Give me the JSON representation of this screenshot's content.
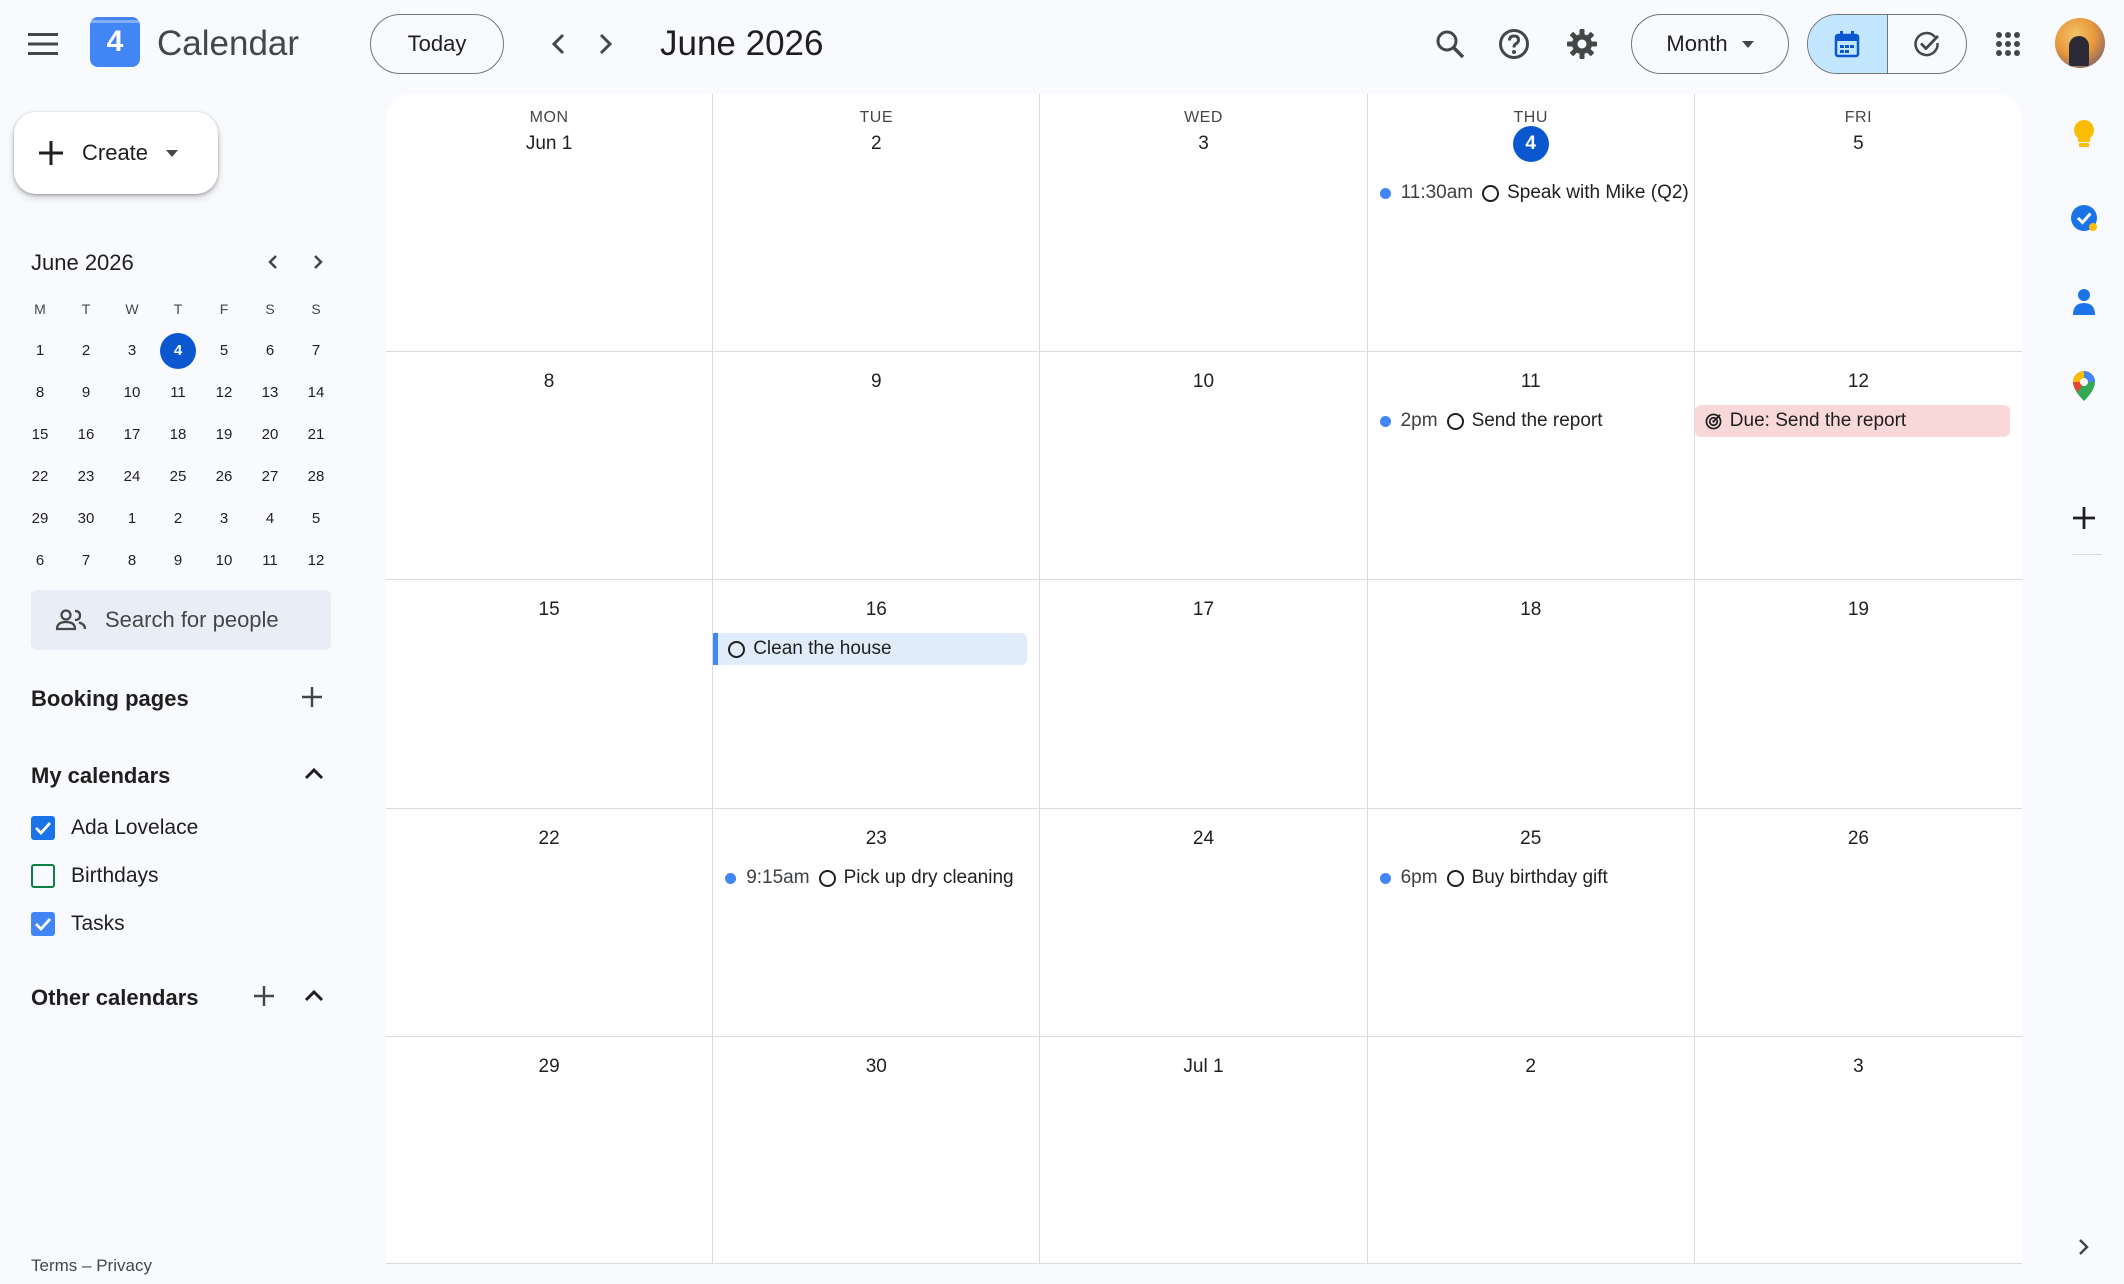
{
  "header": {
    "logo_day": "4",
    "app_title": "Calendar",
    "today_label": "Today",
    "period_title": "June 2026",
    "view_label": "Month"
  },
  "sidebar": {
    "create_label": "Create",
    "mini": {
      "title": "June 2026",
      "weekdays": [
        "M",
        "T",
        "W",
        "T",
        "F",
        "S",
        "S"
      ],
      "weeks": [
        [
          "1",
          "2",
          "3",
          "4",
          "5",
          "6",
          "7"
        ],
        [
          "8",
          "9",
          "10",
          "11",
          "12",
          "13",
          "14"
        ],
        [
          "15",
          "16",
          "17",
          "18",
          "19",
          "20",
          "21"
        ],
        [
          "22",
          "23",
          "24",
          "25",
          "26",
          "27",
          "28"
        ],
        [
          "29",
          "30",
          "1",
          "2",
          "3",
          "4",
          "5"
        ],
        [
          "6",
          "7",
          "8",
          "9",
          "10",
          "11",
          "12"
        ]
      ]
    },
    "search_placeholder": "Search for people",
    "booking_pages": "Booking pages",
    "my_calendars": "My calendars",
    "calendars": [
      {
        "name": "Ada Lovelace",
        "checked": true,
        "color": "#1a73e8"
      },
      {
        "name": "Birthdays",
        "checked": false,
        "color": "#0b8043"
      },
      {
        "name": "Tasks",
        "checked": true,
        "color": "#4285f4"
      }
    ],
    "other_calendars": "Other calendars",
    "footer_terms": "Terms",
    "footer_sep": "–",
    "footer_privacy": "Privacy"
  },
  "grid": {
    "weekdays": [
      "MON",
      "TUE",
      "WED",
      "THU",
      "FRI"
    ],
    "dates": [
      [
        "Jun 1",
        "2",
        "3",
        "4",
        "5"
      ],
      [
        "8",
        "9",
        "10",
        "11",
        "12"
      ],
      [
        "15",
        "16",
        "17",
        "18",
        "19"
      ],
      [
        "22",
        "23",
        "24",
        "25",
        "26"
      ],
      [
        "29",
        "30",
        "Jul 1",
        "2",
        "3"
      ]
    ],
    "events": {
      "e1": {
        "time": "11:30am",
        "title": "Speak with Mike (Q2)"
      },
      "e2": {
        "time": "2pm",
        "title": "Send the report"
      },
      "e3": {
        "title": "Due: Send the report"
      },
      "e4": {
        "title": "Clean the house"
      },
      "e5": {
        "time": "9:15am",
        "title": "Pick up dry cleaning"
      },
      "e6": {
        "time": "6pm",
        "title": "Buy birthday gift"
      }
    }
  },
  "colors": {
    "accent": "#0b57d0",
    "event_dot": "#4285f4",
    "task_chip": "#e1ecfa",
    "due_chip": "#f8d8d8"
  }
}
